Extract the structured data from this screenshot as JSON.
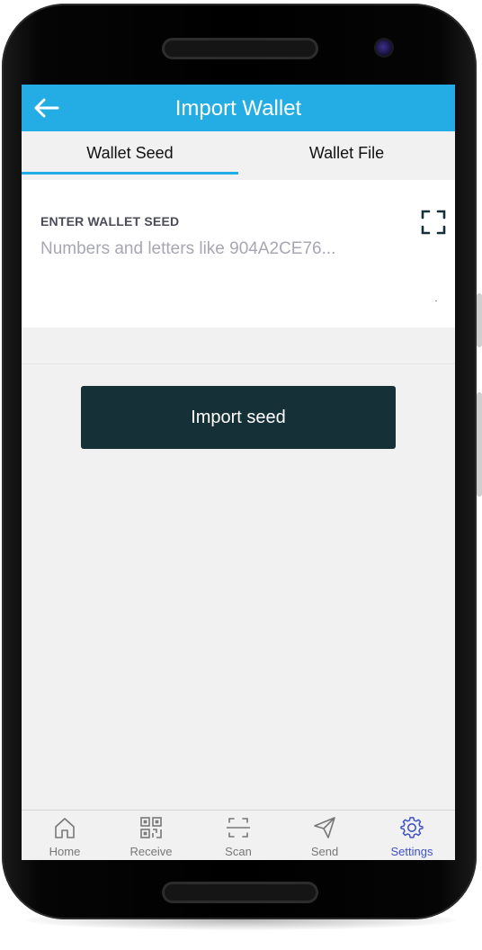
{
  "header": {
    "title": "Import Wallet"
  },
  "tabs": [
    {
      "label": "Wallet Seed",
      "active": true
    },
    {
      "label": "Wallet File",
      "active": false
    }
  ],
  "seed_form": {
    "label": "ENTER WALLET SEED",
    "value": "",
    "placeholder": "Numbers and letters like 904A2CE76..."
  },
  "actions": {
    "import_label": "Import seed"
  },
  "bottom_nav": {
    "items": [
      {
        "label": "Home",
        "icon": "home-icon",
        "active": false
      },
      {
        "label": "Receive",
        "icon": "qr-code-icon",
        "active": false
      },
      {
        "label": "Scan",
        "icon": "scan-icon",
        "active": false
      },
      {
        "label": "Send",
        "icon": "send-icon",
        "active": false
      },
      {
        "label": "Settings",
        "icon": "gear-icon",
        "active": true
      }
    ]
  },
  "colors": {
    "appbar": "#23ade4",
    "primary_button": "#163037",
    "active_nav": "#3f51c8",
    "background": "#f1f1f1"
  }
}
